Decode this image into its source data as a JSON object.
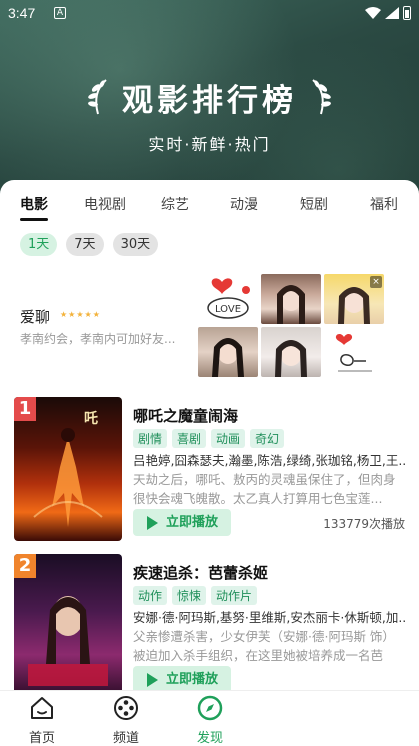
{
  "status_bar": {
    "time": "3:47",
    "indicator": "A"
  },
  "hero": {
    "title": "观影排行榜",
    "subtitle": "实时·新鲜·热门"
  },
  "tabs": [
    {
      "label": "电影",
      "active": true
    },
    {
      "label": "电视剧"
    },
    {
      "label": "综艺"
    },
    {
      "label": "动漫"
    },
    {
      "label": "短剧"
    },
    {
      "label": "福利"
    }
  ],
  "time_filters": [
    {
      "label": "1天",
      "active": true
    },
    {
      "label": "7天"
    },
    {
      "label": "30天"
    }
  ],
  "ad": {
    "title": "爱聊",
    "stars": "★★★★★",
    "desc": "孝南约会，孝南内可加好友...",
    "close": "×",
    "love_text": "LOVE"
  },
  "items": [
    {
      "rank": "1",
      "title": "哪吒之魔童闹海",
      "tags": [
        "剧情",
        "喜剧",
        "动画",
        "奇幻"
      ],
      "cast": "吕艳婷,囧森瑟夫,瀚墨,陈浩,绿绮,张珈铭,杨卫,王...",
      "desc": "天劫之后，哪吒、敖丙的灵魂虽保住了，但肉身很快会魂飞魄散。太乙真人打算用七色宝莲...",
      "play_label": "立即播放",
      "plays": "133779次播放"
    },
    {
      "rank": "2",
      "title": "疾速追杀：芭蕾杀姬",
      "tags": [
        "动作",
        "惊悚",
        "动作片"
      ],
      "cast": "安娜·德·阿玛斯,基努·里维斯,安杰丽卡·休斯顿,加...",
      "desc": "父亲惨遭杀害，少女伊芙（安娜·德·阿玛斯 饰）被迫加入杀手组织，在这里她被培养成一名芭蕾...",
      "play_label": "立即播放",
      "plays": ""
    }
  ],
  "bottom_nav": [
    {
      "label": "首页",
      "icon": "home-icon"
    },
    {
      "label": "频道",
      "icon": "film-reel-icon"
    },
    {
      "label": "发现",
      "icon": "compass-icon",
      "active": true
    }
  ],
  "colors": {
    "accent": "#1fa05a",
    "hero_bg": "#2b4a43",
    "rank1": "#e44b4b",
    "rank2": "#f0842c"
  }
}
